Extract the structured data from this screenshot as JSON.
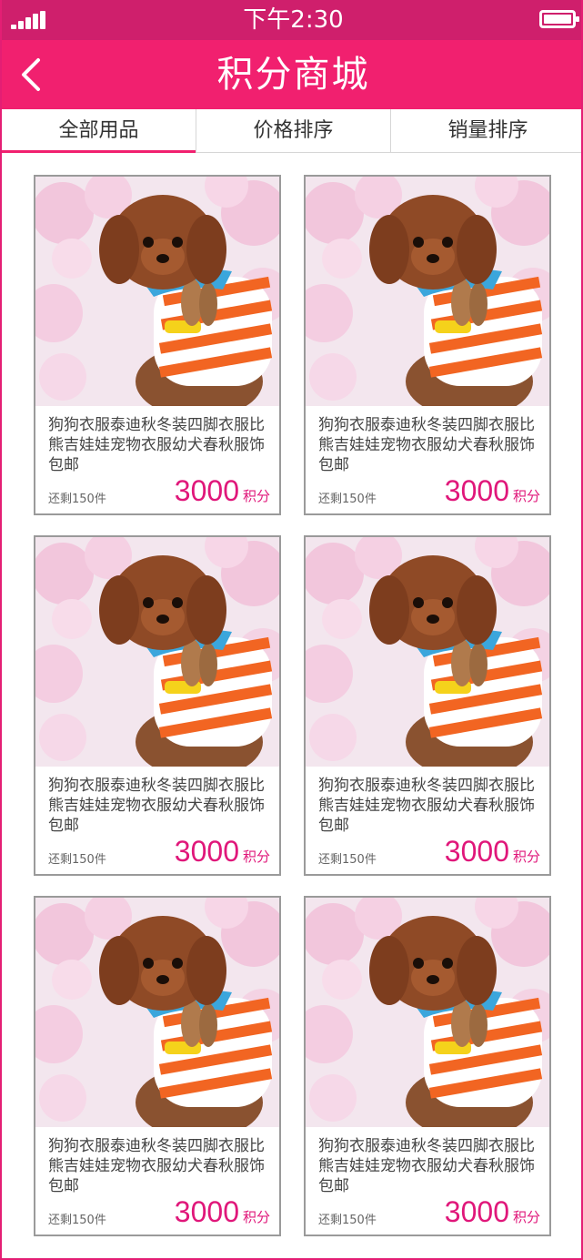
{
  "status_bar": {
    "time": "下午2:30"
  },
  "nav": {
    "title": "积分商城"
  },
  "tabs": [
    {
      "label": "全部用品"
    },
    {
      "label": "价格排序"
    },
    {
      "label": "销量排序"
    }
  ],
  "colors": {
    "brand": "#f1206f",
    "status_bar": "#cf1f6c",
    "price": "#e0177a"
  },
  "products": [
    {
      "title": "狗狗衣服泰迪秋冬装四脚衣服比熊吉娃娃宠物衣服幼犬春秋服饰包邮",
      "stock": "还剩150件",
      "points": "3000",
      "unit": "积分"
    },
    {
      "title": "狗狗衣服泰迪秋冬装四脚衣服比熊吉娃娃宠物衣服幼犬春秋服饰包邮",
      "stock": "还剩150件",
      "points": "3000",
      "unit": "积分"
    },
    {
      "title": "狗狗衣服泰迪秋冬装四脚衣服比熊吉娃娃宠物衣服幼犬春秋服饰包邮",
      "stock": "还剩150件",
      "points": "3000",
      "unit": "积分"
    },
    {
      "title": "狗狗衣服泰迪秋冬装四脚衣服比熊吉娃娃宠物衣服幼犬春秋服饰包邮",
      "stock": "还剩150件",
      "points": "3000",
      "unit": "积分"
    },
    {
      "title": "狗狗衣服泰迪秋冬装四脚衣服比熊吉娃娃宠物衣服幼犬春秋服饰包邮",
      "stock": "还剩150件",
      "points": "3000",
      "unit": "积分"
    },
    {
      "title": "狗狗衣服泰迪秋冬装四脚衣服比熊吉娃娃宠物衣服幼犬春秋服饰包邮",
      "stock": "还剩150件",
      "points": "3000",
      "unit": "积分"
    }
  ]
}
